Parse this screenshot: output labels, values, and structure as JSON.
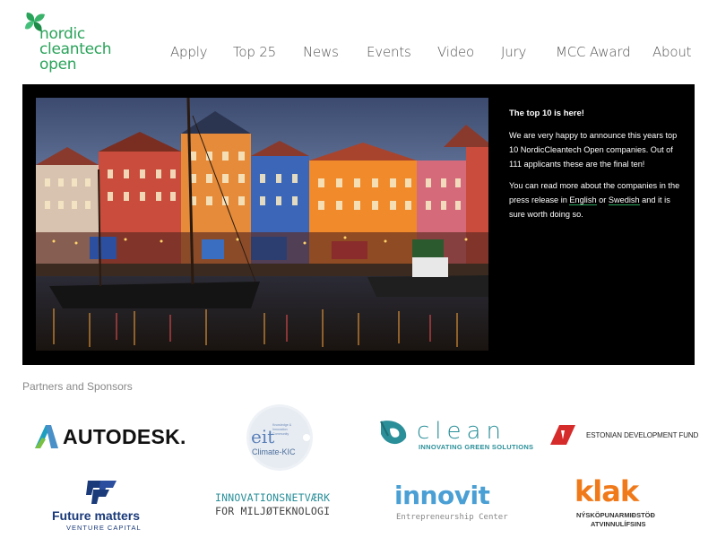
{
  "brand": {
    "logo_lines": [
      "nordic",
      "cleantech",
      "open"
    ],
    "color": "#2aa35a"
  },
  "nav": {
    "items": [
      "Apply",
      "Top 25",
      "News",
      "Events",
      "Video",
      "Jury",
      "MCC Award",
      "About"
    ]
  },
  "hero": {
    "headline": "The top 10 is here!",
    "paragraph1": "We are very happy to announce this years top 10 NordicCleantech Open companies. Out of 111 applicants these are the final ten!",
    "paragraph2_before": "You can read more about the companies in the press release in ",
    "link_english": "English",
    "paragraph2_or": " or ",
    "link_swedish": "Swedish",
    "paragraph2_after": " and it is sure worth doing so."
  },
  "partners": {
    "title": "Partners and Sponsors",
    "autodesk": "AUTODESK.",
    "eit_name": "eit",
    "eit_small": "Knowledge & Innovation Community",
    "eit_sub": "Climate-KIC",
    "clean_name": "clean",
    "clean_tagline": "INNOVATING GREEN SOLUTIONS",
    "estonian": "ESTONIAN DEVELOPMENT FUND",
    "future_name": "Future matters",
    "future_sub": "VENTURE CAPITAL",
    "innovations_line1": "INNOVATIONSNETVÆRK",
    "innovations_line2": "FOR  MILJØTEKNOLOGI",
    "innovit_name": "innovit",
    "innovit_sub": "Entrepreneurship Center",
    "klak_name": "klak",
    "klak_line1": "NÝSKÖPUNARMIÐSTÖÐ",
    "klak_line2": "ATVINNULÍFSINS"
  }
}
